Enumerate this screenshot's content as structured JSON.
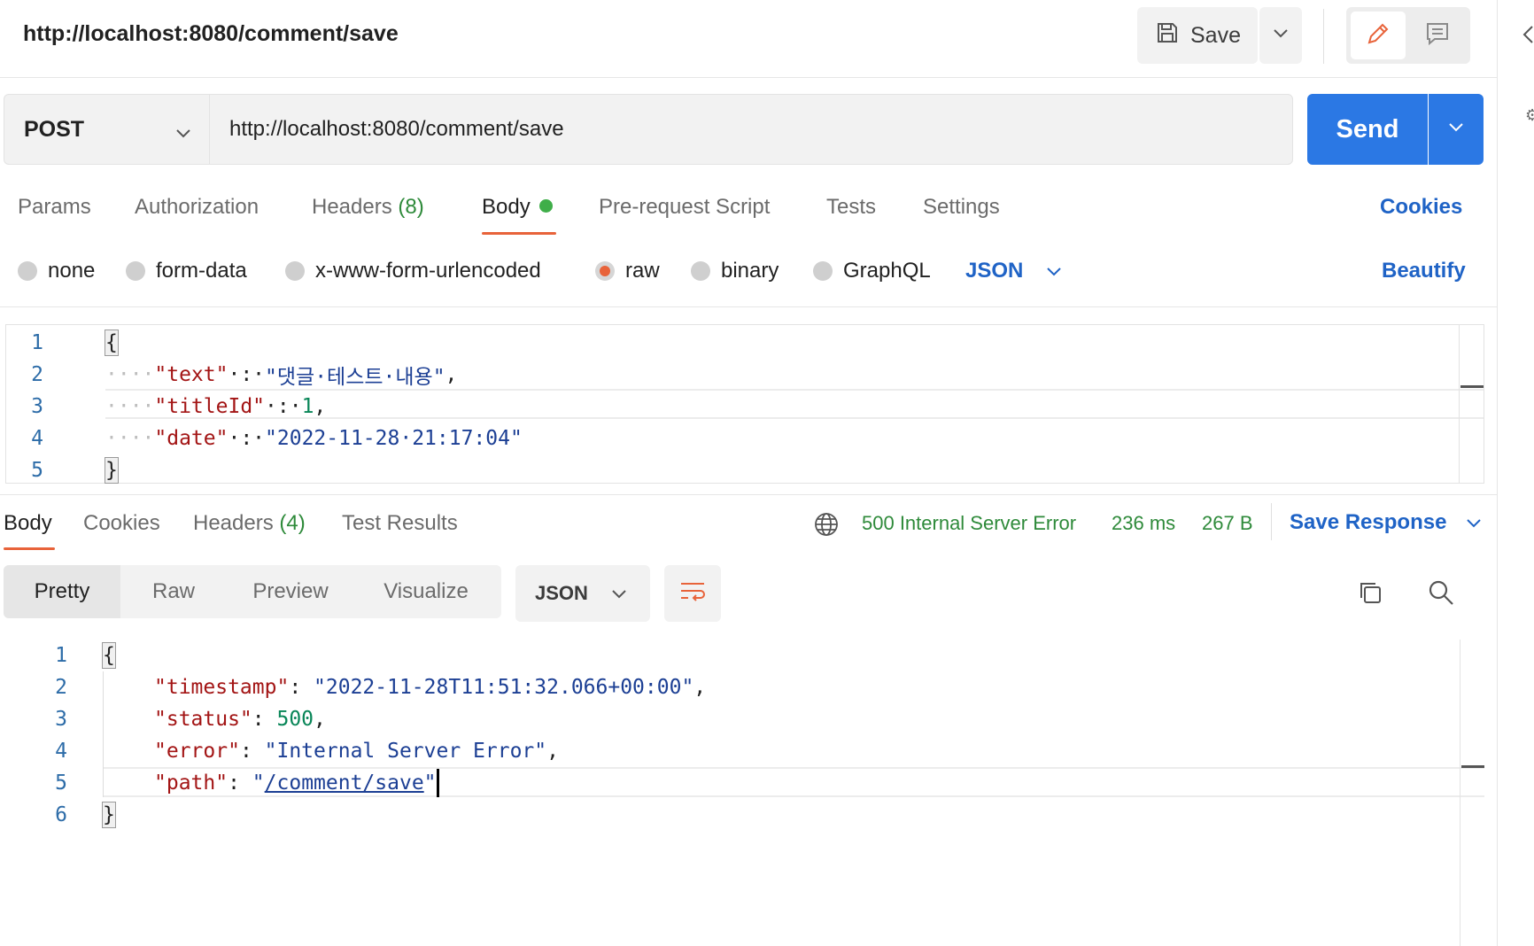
{
  "request": {
    "title": "http://localhost:8080/comment/save",
    "save_label": "Save",
    "method": "POST",
    "url": "http://localhost:8080/comment/save",
    "send_label": "Send"
  },
  "request_tabs": [
    {
      "label": "Params"
    },
    {
      "label": "Authorization"
    },
    {
      "label": "Headers",
      "count": "(8)"
    },
    {
      "label": "Body"
    },
    {
      "label": "Pre-request Script"
    },
    {
      "label": "Tests"
    },
    {
      "label": "Settings"
    }
  ],
  "cookies_label": "Cookies",
  "beautify_label": "Beautify",
  "body_types": [
    "none",
    "form-data",
    "x-www-form-urlencoded",
    "raw",
    "binary",
    "GraphQL"
  ],
  "body_format": "JSON",
  "request_body": {
    "line_numbers": [
      "1",
      "2",
      "3",
      "4",
      "5"
    ],
    "open_brace": "{",
    "close_brace": "}",
    "k_text": "\"text\"",
    "v_text": "\"댓글·테스트·내용\"",
    "k_title": "\"titleId\"",
    "v_title": "1",
    "k_date": "\"date\"",
    "v_date": "\"2022-11-28·21:17:04\"",
    "indent": "····",
    "sep": "·:·",
    "comma": ","
  },
  "response_tabs": [
    {
      "label": "Body"
    },
    {
      "label": "Cookies"
    },
    {
      "label": "Headers",
      "count": "(4)"
    },
    {
      "label": "Test Results"
    }
  ],
  "response_status": {
    "status": "500 Internal Server Error",
    "time": "236 ms",
    "size": "267 B",
    "save_response_label": "Save Response"
  },
  "response_views": [
    "Pretty",
    "Raw",
    "Preview",
    "Visualize"
  ],
  "response_format": "JSON",
  "response_body": {
    "line_numbers": [
      "1",
      "2",
      "3",
      "4",
      "5",
      "6"
    ],
    "open_brace": "{",
    "close_brace": "}",
    "k_timestamp": "\"timestamp\"",
    "v_timestamp": "\"2022-11-28T11:51:32.066+00:00\"",
    "k_status": "\"status\"",
    "v_status": "500",
    "k_error": "\"error\"",
    "v_error": "\"Internal Server Error\"",
    "k_path": "\"path\"",
    "v_path_quote": "\"",
    "v_path": "/comment/save",
    "colon": ": ",
    "comma": ","
  },
  "colors": {
    "accent": "#e8633a",
    "primary": "#2b78e4",
    "link": "#1f63c6",
    "success": "#2e8a3a"
  },
  "icons": [
    "save-icon",
    "chevron-down-icon",
    "pencil-icon",
    "comment-icon",
    "globe-icon",
    "wrap-icon",
    "copy-icon",
    "search-icon",
    "chevron-left-icon"
  ]
}
